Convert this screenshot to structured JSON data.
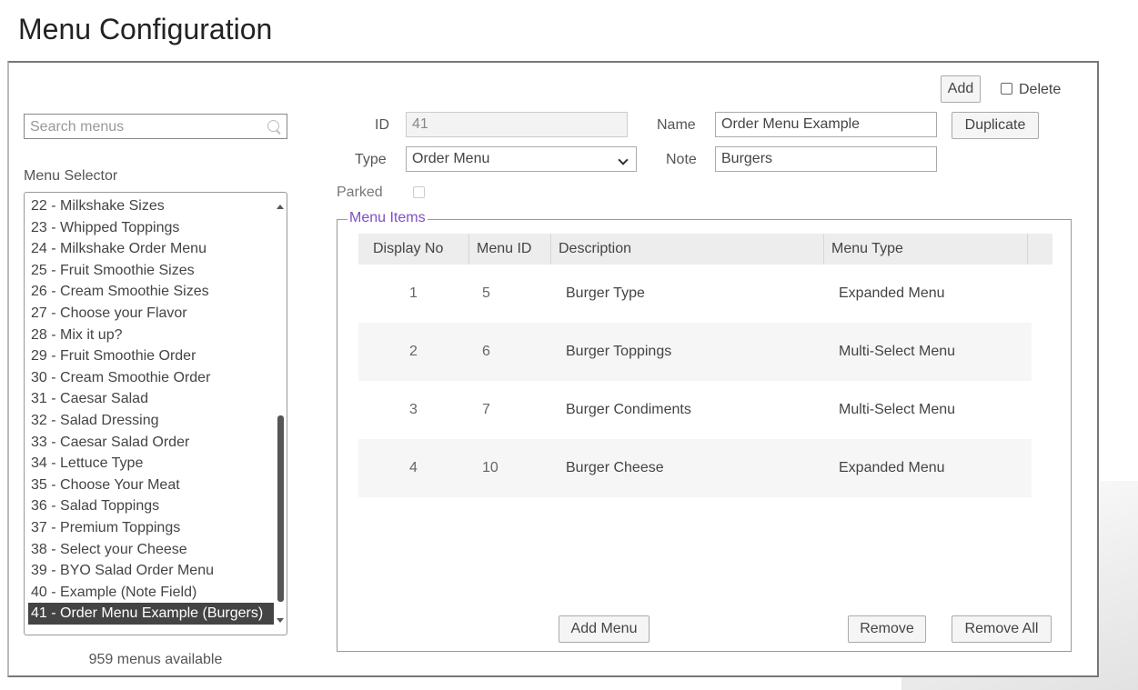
{
  "page": {
    "title": "Menu Configuration"
  },
  "search": {
    "placeholder": "Search menus"
  },
  "menu_selector": {
    "label": "Menu Selector",
    "items": [
      "22 - Milkshake Sizes",
      "23 - Whipped Toppings",
      "24 - Milkshake Order Menu",
      "25 - Fruit Smoothie Sizes",
      "26 - Cream Smoothie Sizes",
      "27 - Choose your Flavor",
      "28 - Mix it up?",
      "29 - Fruit Smoothie Order",
      "30 - Cream Smoothie Order",
      "31 - Caesar Salad",
      "32 - Salad Dressing",
      "33 - Caesar Salad Order",
      "34 - Lettuce Type",
      "35 - Choose Your Meat",
      "36 - Salad Toppings",
      "37 - Premium Toppings",
      "38 - Select your Cheese",
      "39 - BYO Salad Order Menu",
      "40 - Example (Note Field)",
      "41 - Order Menu Example (Burgers)"
    ],
    "selected_index": 19,
    "count_text": "959 menus available"
  },
  "toolbar": {
    "add_label": "Add",
    "delete_label": "Delete",
    "delete_checked": false
  },
  "form": {
    "id_label": "ID",
    "id_value": "41",
    "name_label": "Name",
    "name_value": "Order Menu Example",
    "duplicate_label": "Duplicate",
    "type_label": "Type",
    "type_value": "Order Menu",
    "note_label": "Note",
    "note_value": "Burgers",
    "parked_label": "Parked",
    "parked_checked": false
  },
  "menu_items": {
    "legend": "Menu Items",
    "columns": [
      "Display No",
      "Menu ID",
      "Description",
      "Menu Type"
    ],
    "rows": [
      {
        "display_no": "1",
        "menu_id": "5",
        "description": "Burger Type",
        "menu_type": "Expanded Menu"
      },
      {
        "display_no": "2",
        "menu_id": "6",
        "description": "Burger Toppings",
        "menu_type": "Multi-Select Menu"
      },
      {
        "display_no": "3",
        "menu_id": "7",
        "description": "Burger Condiments",
        "menu_type": "Multi-Select Menu"
      },
      {
        "display_no": "4",
        "menu_id": "10",
        "description": "Burger Cheese",
        "menu_type": "Expanded Menu"
      }
    ],
    "add_menu_label": "Add Menu",
    "remove_label": "Remove",
    "remove_all_label": "Remove All"
  },
  "colors": {
    "legend": "#7b4fc8",
    "selected_bg": "#444444",
    "selected_fg": "#ffffff"
  }
}
